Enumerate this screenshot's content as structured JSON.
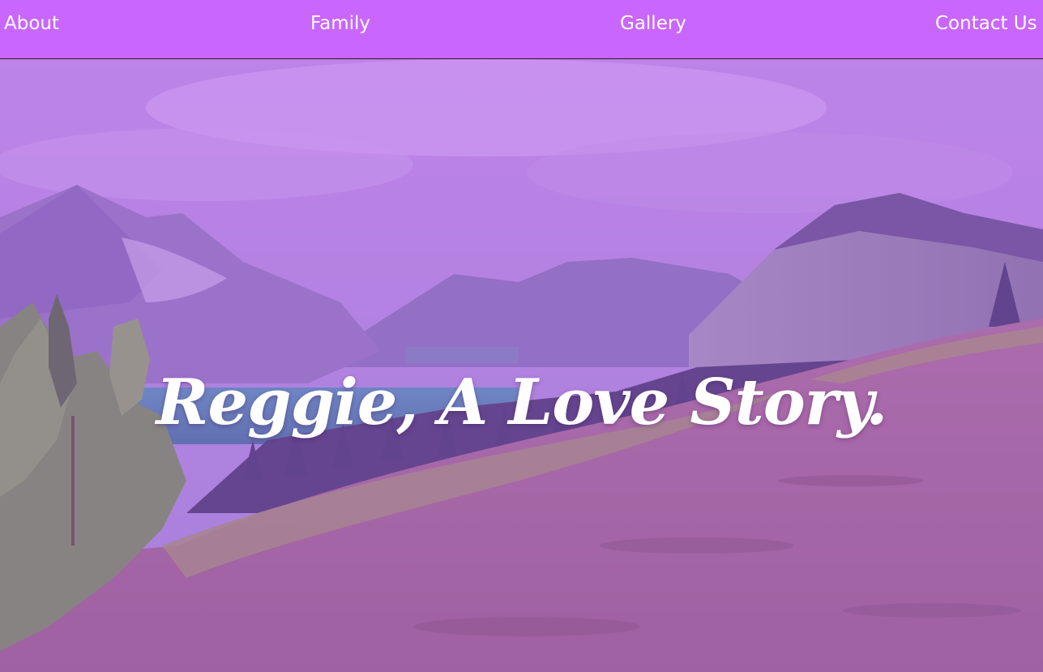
{
  "nav": {
    "items": [
      {
        "label": "About"
      },
      {
        "label": "Family"
      },
      {
        "label": "Gallery"
      },
      {
        "label": "Contact Us"
      }
    ]
  },
  "hero": {
    "headline": "Reggie, A Love Story."
  },
  "colors": {
    "nav_background": "#c966fd",
    "nav_text": "#ffffff",
    "headline_text": "#ffffff",
    "overlay_tint": "#c86efa"
  }
}
